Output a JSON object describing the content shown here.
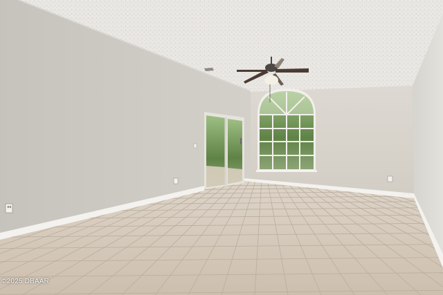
{
  "photo": {
    "subject": "empty-room-interior",
    "watermark": "©2025 DBAAR"
  },
  "colors": {
    "ceiling": "#e8e6e2",
    "wall_left": "#cbc8c1",
    "wall_back": "#d8d4cc",
    "wall_right": "#dbd9d4",
    "floor": "#d3c8b9",
    "grout": "#b7aa98",
    "baseboard": "#f4f2ee",
    "foliage": "#6f8f52"
  }
}
